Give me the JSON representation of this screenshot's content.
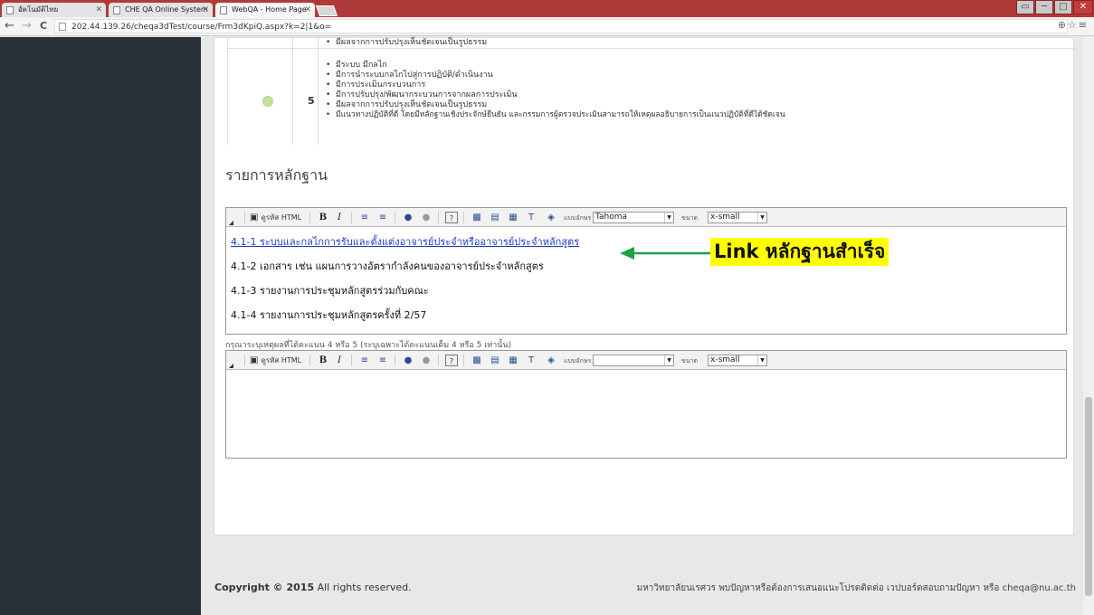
{
  "browser": {
    "tabs": [
      {
        "label": "อัตโนมัติไทย"
      },
      {
        "label": "CHE QA Online System"
      },
      {
        "label": "WebQA - Home Page"
      }
    ],
    "url": "202.44.139.26/cheqa3dTest/course/Frm3dKpiQ.aspx?k=2|1&o=",
    "back_icon": "←",
    "forward_icon": "→",
    "reload_icon": "C",
    "zoom_star_icons": "⊕☆≡",
    "window_controls": [
      "▭",
      "─",
      "□",
      "✕"
    ]
  },
  "criteria": {
    "top_partial": "มีผลจากการปรับปรุงเห็นชัดเจนเป็นรูปธรรม",
    "score": "5",
    "items": [
      "มีระบบ มีกลไก",
      "มีการนำระบบกลไกไปสู่การปฏิบัติ/ดำเนินงาน",
      "มีการประเมินกระบวนการ",
      "มีการปรับปรุง/พัฒนากระบวนการจากผลการประเมิน",
      "มีผลจากการปรับปรุงเห็นชัดเจนเป็นรูปธรรม",
      "มีแนวทางปฏิบัติที่ดี  โดยมีหลักฐานเชิงประจักษ์ยืนยัน และกรรมการผู้ตรวจประเมินสามารถให้เหตุผลอธิบายการเป็นแนวปฏิบัติที่ดีได้ชัดเจน"
    ]
  },
  "evidence": {
    "title": "รายการหลักฐาน",
    "items": [
      {
        "text": "4.1-1 ระบบและกลไกการรับและตั้งแต่งอาจารย์ประจำหรืออาจารย์ประจำหลักสูตร",
        "link": true
      },
      {
        "text": "4.1-2 เอกสาร เช่น แผนการวางอัตรากำลังคนของอาจารย์ประจำหลักสูตร",
        "link": false
      },
      {
        "text": "4.1-3 รายงานการประชุมหลักสูตรร่วมกับคณะ",
        "link": false
      },
      {
        "text": "4.1-4 รายงานการประชุมหลักสูตรครั้งที่ 2/57",
        "link": false
      }
    ],
    "annotation": "Link หลักฐานสำเร็จ"
  },
  "editor_toolbar": {
    "html_label": "ดูรหัส HTML",
    "bold": "B",
    "italic": "I",
    "font_label": "แบบอักษร",
    "size_label": "ขนาด",
    "font_value_1": "Tahoma",
    "font_value_2": "",
    "size_value": "x-small"
  },
  "reason": {
    "label": "กรุณาระบุเหตุผลที่ได้คะแนน 4 หรือ 5 (ระบุเฉพาะได้คะแนนเต็ม 4 หรือ 5 เท่านั้น)"
  },
  "footer": {
    "copyright_bold": "Copyright © 2015",
    "copyright_rest": " All rights reserved.",
    "contact": "มหาวิทยาลัยนเรศวร พบปัญหาหรือต้องการเสนอแนะโปรดติดต่อ เวปบอร์ดสอบถามปัญหา หรือ cheqa@nu.ac.th"
  },
  "colors": {
    "accent": "#b03a3a",
    "link": "#1a3cc5",
    "highlight": "#ffff00",
    "arrow": "#1fa04a"
  }
}
